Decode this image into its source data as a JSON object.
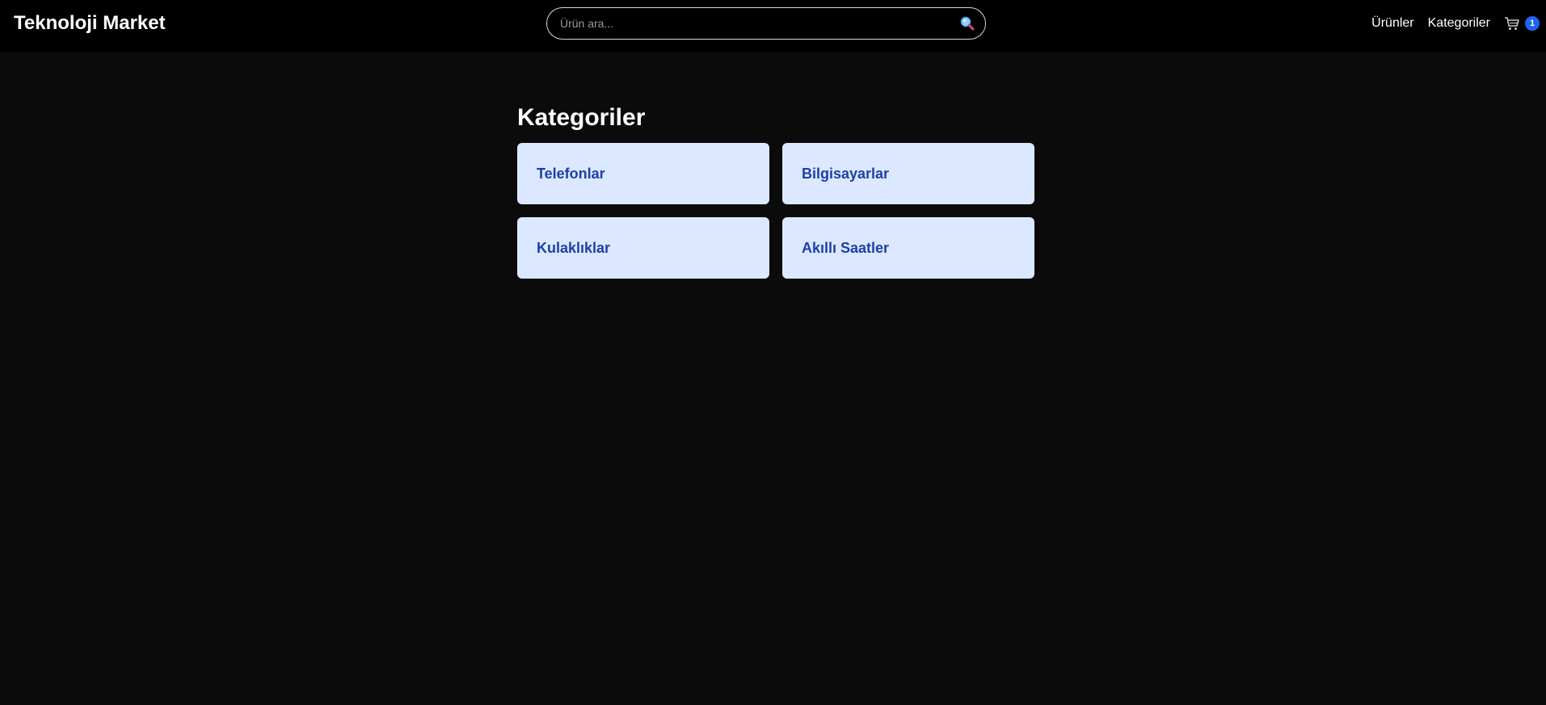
{
  "header": {
    "brand": "Teknoloji Market",
    "search_placeholder": "Ürün ara...",
    "search_icon": "magnifier-icon",
    "nav": {
      "products": "Ürünler",
      "categories": "Kategoriler"
    },
    "cart": {
      "icon": "cart-icon",
      "count": "1"
    }
  },
  "main": {
    "title": "Kategoriler",
    "categories": [
      {
        "label": "Telefonlar"
      },
      {
        "label": "Bilgisayarlar"
      },
      {
        "label": "Kulaklıklar"
      },
      {
        "label": "Akıllı Saatler"
      }
    ]
  },
  "colors": {
    "page_bg": "#0b0b0b",
    "header_bg": "#000000",
    "card_bg": "#dbe8ff",
    "card_text": "#1e3fa8",
    "badge": "#1d63ee"
  }
}
